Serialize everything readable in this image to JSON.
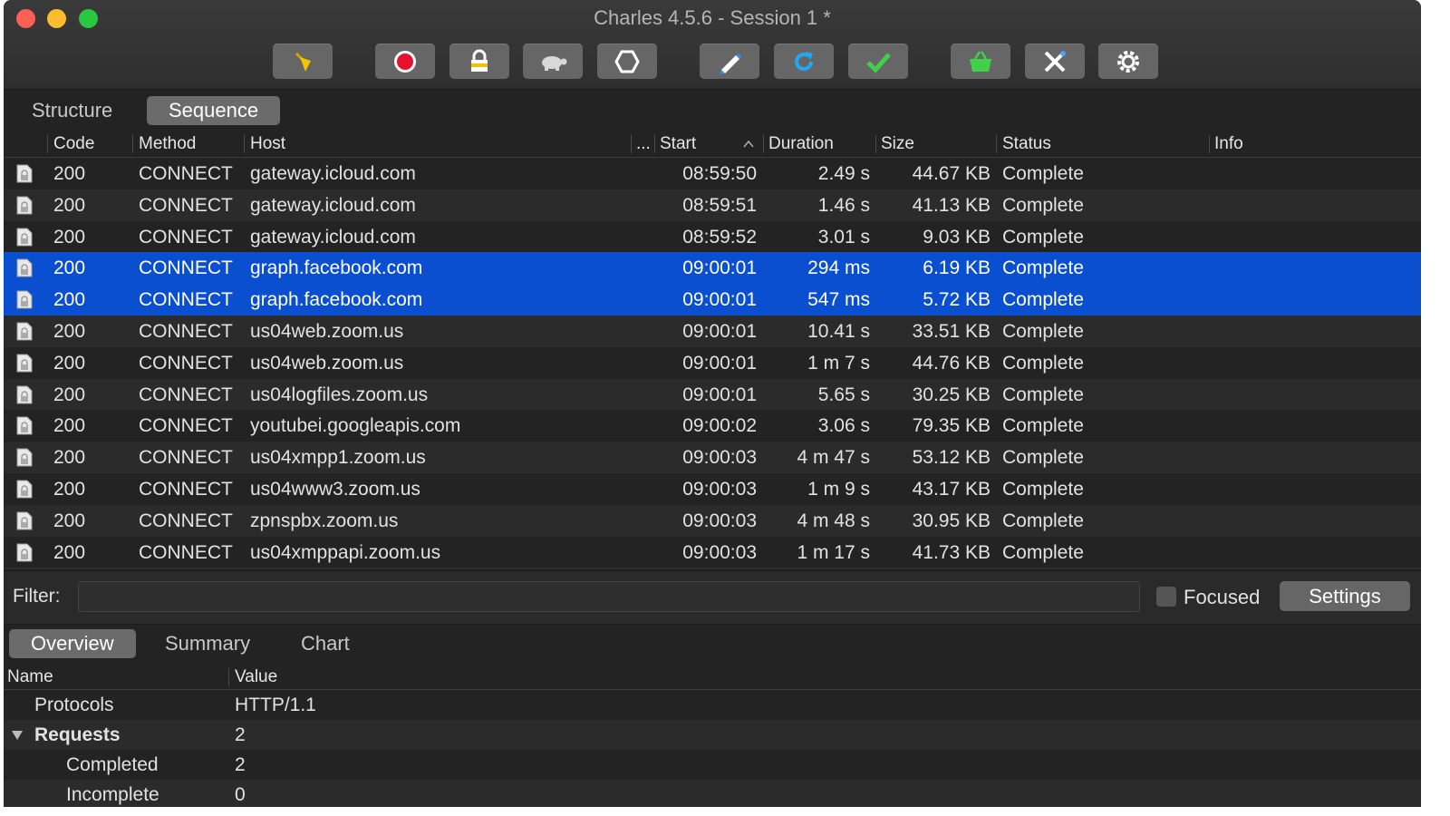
{
  "window": {
    "title": "Charles 4.5.6 - Session 1 *"
  },
  "toolbar": {
    "buttons": [
      {
        "icon": "broom-icon"
      },
      {
        "icon": "record-icon"
      },
      {
        "icon": "ssl-lock-icon"
      },
      {
        "icon": "throttle-turtle-icon"
      },
      {
        "icon": "breakpoint-hexagon-icon"
      },
      {
        "icon": "compose-pen-icon"
      },
      {
        "icon": "repeat-icon"
      },
      {
        "icon": "validate-check-icon"
      },
      {
        "icon": "basket-icon"
      },
      {
        "icon": "tools-icon"
      },
      {
        "icon": "settings-gear-icon"
      }
    ]
  },
  "view_tabs": [
    "Structure",
    "Sequence"
  ],
  "columns": {
    "code": "Code",
    "method": "Method",
    "host": "Host",
    "path": "...",
    "start": "Start",
    "duration": "Duration",
    "size": "Size",
    "status": "Status",
    "info": "Info"
  },
  "requests": [
    {
      "code": "200",
      "method": "CONNECT",
      "host": "gateway.icloud.com",
      "start": "08:59:50",
      "duration": "2.49 s",
      "size": "44.67 KB",
      "status": "Complete",
      "selected": false
    },
    {
      "code": "200",
      "method": "CONNECT",
      "host": "gateway.icloud.com",
      "start": "08:59:51",
      "duration": "1.46 s",
      "size": "41.13 KB",
      "status": "Complete",
      "selected": false
    },
    {
      "code": "200",
      "method": "CONNECT",
      "host": "gateway.icloud.com",
      "start": "08:59:52",
      "duration": "3.01 s",
      "size": "9.03 KB",
      "status": "Complete",
      "selected": false
    },
    {
      "code": "200",
      "method": "CONNECT",
      "host": "graph.facebook.com",
      "start": "09:00:01",
      "duration": "294 ms",
      "size": "6.19 KB",
      "status": "Complete",
      "selected": true
    },
    {
      "code": "200",
      "method": "CONNECT",
      "host": "graph.facebook.com",
      "start": "09:00:01",
      "duration": "547 ms",
      "size": "5.72 KB",
      "status": "Complete",
      "selected": true
    },
    {
      "code": "200",
      "method": "CONNECT",
      "host": "us04web.zoom.us",
      "start": "09:00:01",
      "duration": "10.41 s",
      "size": "33.51 KB",
      "status": "Complete",
      "selected": false
    },
    {
      "code": "200",
      "method": "CONNECT",
      "host": "us04web.zoom.us",
      "start": "09:00:01",
      "duration": "1 m 7 s",
      "size": "44.76 KB",
      "status": "Complete",
      "selected": false
    },
    {
      "code": "200",
      "method": "CONNECT",
      "host": "us04logfiles.zoom.us",
      "start": "09:00:01",
      "duration": "5.65 s",
      "size": "30.25 KB",
      "status": "Complete",
      "selected": false
    },
    {
      "code": "200",
      "method": "CONNECT",
      "host": "youtubei.googleapis.com",
      "start": "09:00:02",
      "duration": "3.06 s",
      "size": "79.35 KB",
      "status": "Complete",
      "selected": false
    },
    {
      "code": "200",
      "method": "CONNECT",
      "host": "us04xmpp1.zoom.us",
      "start": "09:00:03",
      "duration": "4 m 47 s",
      "size": "53.12 KB",
      "status": "Complete",
      "selected": false
    },
    {
      "code": "200",
      "method": "CONNECT",
      "host": "us04www3.zoom.us",
      "start": "09:00:03",
      "duration": "1 m 9 s",
      "size": "43.17 KB",
      "status": "Complete",
      "selected": false
    },
    {
      "code": "200",
      "method": "CONNECT",
      "host": "zpnspbx.zoom.us",
      "start": "09:00:03",
      "duration": "4 m 48 s",
      "size": "30.95 KB",
      "status": "Complete",
      "selected": false
    },
    {
      "code": "200",
      "method": "CONNECT",
      "host": "us04xmppapi.zoom.us",
      "start": "09:00:03",
      "duration": "1 m 17 s",
      "size": "41.73 KB",
      "status": "Complete",
      "selected": false
    }
  ],
  "filter": {
    "label": "Filter:",
    "value": "",
    "focused_label": "Focused",
    "settings_label": "Settings"
  },
  "detail_tabs": [
    "Overview",
    "Summary",
    "Chart"
  ],
  "overview": {
    "name_header": "Name",
    "value_header": "Value",
    "rows": [
      {
        "name": "Protocols",
        "value": "HTTP/1.1",
        "indent": 1,
        "bold": false,
        "expander": false
      },
      {
        "name": "Requests",
        "value": "2",
        "indent": 1,
        "bold": true,
        "expander": true
      },
      {
        "name": "Completed",
        "value": "2",
        "indent": 2,
        "bold": false,
        "expander": false
      },
      {
        "name": "Incomplete",
        "value": "0",
        "indent": 2,
        "bold": false,
        "expander": false
      }
    ]
  }
}
